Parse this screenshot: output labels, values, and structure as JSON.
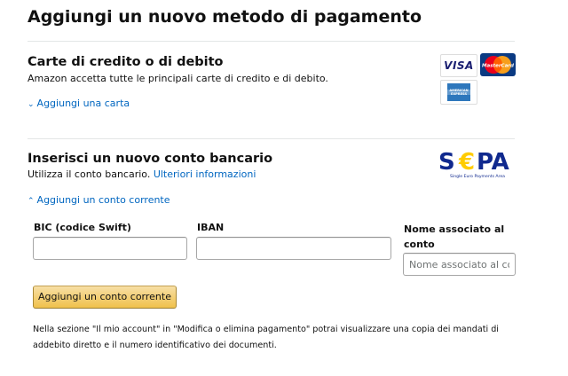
{
  "page": {
    "title": "Aggiungi un nuovo metodo di pagamento"
  },
  "cards_section": {
    "heading": "Carte di credito o di debito",
    "description": "Amazon accetta tutte le principali carte di credito e di debito.",
    "add_card_link": "Aggiungi una carta",
    "logos": {
      "visa_text": "VISA",
      "mastercard_text": "MasterCard",
      "amex_text": "AMERICAN EXPRESS"
    }
  },
  "bank_section": {
    "heading": "Inserisci un nuovo conto bancario",
    "description": "Utilizza il conto bancario.",
    "more_info_link": "Ulteriori informazioni",
    "add_account_link": "Aggiungi un conto corrente",
    "sepa_logo": {
      "text_s": "S",
      "text_pa": "PA",
      "tagline": "Single Euro Payments Area"
    },
    "fields": {
      "bic_label": "BIC (codice Swift)",
      "bic_value": "",
      "iban_label": "IBAN",
      "iban_value": "",
      "name_label": "Nome associato al conto",
      "name_placeholder": "Nome associato al conto",
      "name_value": ""
    },
    "submit_button": "Aggiungi un conto corrente",
    "note": "Nella sezione \"Il mio account\" in \"Modifica o elimina pagamento\" potrai visualizzare una copia dei mandati di addebito diretto e il numero identificativo dei documenti."
  },
  "colors": {
    "link": "#0066c0",
    "button_top": "#f7dfa5",
    "button_bottom": "#f0c14b",
    "sepa_blue": "#10298e",
    "sepa_yellow": "#ffcc00"
  },
  "icons": {
    "expand": "chevron-down-icon",
    "collapse": "chevron-up-icon"
  }
}
